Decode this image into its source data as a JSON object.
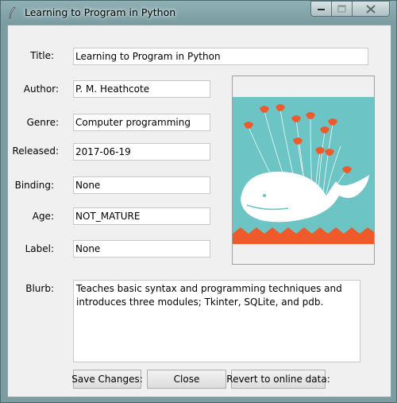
{
  "window": {
    "title": "Learning to Program in Python",
    "controls": {
      "minimize_icon": "minimize-icon",
      "maximize_icon": "maximize-icon",
      "close_icon": "close-icon"
    }
  },
  "form": {
    "title": {
      "label": "Title:",
      "value": "Learning to Program in Python"
    },
    "author": {
      "label": "Author:",
      "value": "P. M. Heathcote"
    },
    "genre": {
      "label": "Genre:",
      "value": "Computer programming"
    },
    "released": {
      "label": "Released:",
      "value": "2017-06-19"
    },
    "binding": {
      "label": "Binding:",
      "value": "None"
    },
    "age": {
      "label": "Age:",
      "value": "NOT_MATURE"
    },
    "label": {
      "label": "Label:",
      "value": "None"
    },
    "blurb": {
      "label": "Blurb:",
      "value": "Teaches basic syntax and programming techniques and introduces three modules; Tkinter, SQLite, and pdb."
    }
  },
  "cover_image": {
    "icon": "fail-whale-image",
    "colors": {
      "sky": "#6cc4c4",
      "whale": "#ffffff",
      "waves": "#ef5a2a",
      "birds": "#ef5a2a"
    }
  },
  "buttons": {
    "save": "Save Changes:",
    "close": "Close",
    "revert": "Revert to online data:"
  }
}
